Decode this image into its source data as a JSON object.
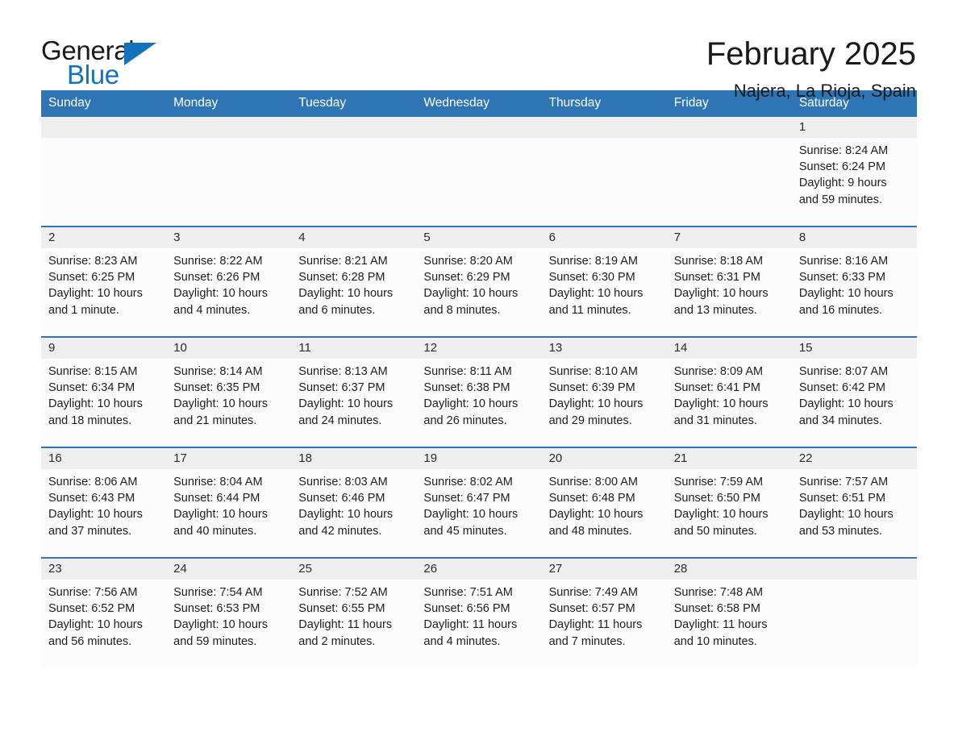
{
  "brand": {
    "name_part1": "General",
    "name_part2": "Blue",
    "accent_color": "#1272bb"
  },
  "header": {
    "month_title": "February 2025",
    "location": "Najera, La Rioja, Spain"
  },
  "calendar": {
    "header_color": "#2e75b6",
    "weekday_headers": [
      "Sunday",
      "Monday",
      "Tuesday",
      "Wednesday",
      "Thursday",
      "Friday",
      "Saturday"
    ],
    "weeks": [
      [
        {
          "empty": true
        },
        {
          "empty": true
        },
        {
          "empty": true
        },
        {
          "empty": true
        },
        {
          "empty": true
        },
        {
          "empty": true
        },
        {
          "day": "1",
          "sunrise": "Sunrise: 8:24 AM",
          "sunset": "Sunset: 6:24 PM",
          "daylight_line1": "Daylight: 9 hours",
          "daylight_line2": "and 59 minutes."
        }
      ],
      [
        {
          "day": "2",
          "sunrise": "Sunrise: 8:23 AM",
          "sunset": "Sunset: 6:25 PM",
          "daylight_line1": "Daylight: 10 hours",
          "daylight_line2": "and 1 minute."
        },
        {
          "day": "3",
          "sunrise": "Sunrise: 8:22 AM",
          "sunset": "Sunset: 6:26 PM",
          "daylight_line1": "Daylight: 10 hours",
          "daylight_line2": "and 4 minutes."
        },
        {
          "day": "4",
          "sunrise": "Sunrise: 8:21 AM",
          "sunset": "Sunset: 6:28 PM",
          "daylight_line1": "Daylight: 10 hours",
          "daylight_line2": "and 6 minutes."
        },
        {
          "day": "5",
          "sunrise": "Sunrise: 8:20 AM",
          "sunset": "Sunset: 6:29 PM",
          "daylight_line1": "Daylight: 10 hours",
          "daylight_line2": "and 8 minutes."
        },
        {
          "day": "6",
          "sunrise": "Sunrise: 8:19 AM",
          "sunset": "Sunset: 6:30 PM",
          "daylight_line1": "Daylight: 10 hours",
          "daylight_line2": "and 11 minutes."
        },
        {
          "day": "7",
          "sunrise": "Sunrise: 8:18 AM",
          "sunset": "Sunset: 6:31 PM",
          "daylight_line1": "Daylight: 10 hours",
          "daylight_line2": "and 13 minutes."
        },
        {
          "day": "8",
          "sunrise": "Sunrise: 8:16 AM",
          "sunset": "Sunset: 6:33 PM",
          "daylight_line1": "Daylight: 10 hours",
          "daylight_line2": "and 16 minutes."
        }
      ],
      [
        {
          "day": "9",
          "sunrise": "Sunrise: 8:15 AM",
          "sunset": "Sunset: 6:34 PM",
          "daylight_line1": "Daylight: 10 hours",
          "daylight_line2": "and 18 minutes."
        },
        {
          "day": "10",
          "sunrise": "Sunrise: 8:14 AM",
          "sunset": "Sunset: 6:35 PM",
          "daylight_line1": "Daylight: 10 hours",
          "daylight_line2": "and 21 minutes."
        },
        {
          "day": "11",
          "sunrise": "Sunrise: 8:13 AM",
          "sunset": "Sunset: 6:37 PM",
          "daylight_line1": "Daylight: 10 hours",
          "daylight_line2": "and 24 minutes."
        },
        {
          "day": "12",
          "sunrise": "Sunrise: 8:11 AM",
          "sunset": "Sunset: 6:38 PM",
          "daylight_line1": "Daylight: 10 hours",
          "daylight_line2": "and 26 minutes."
        },
        {
          "day": "13",
          "sunrise": "Sunrise: 8:10 AM",
          "sunset": "Sunset: 6:39 PM",
          "daylight_line1": "Daylight: 10 hours",
          "daylight_line2": "and 29 minutes."
        },
        {
          "day": "14",
          "sunrise": "Sunrise: 8:09 AM",
          "sunset": "Sunset: 6:41 PM",
          "daylight_line1": "Daylight: 10 hours",
          "daylight_line2": "and 31 minutes."
        },
        {
          "day": "15",
          "sunrise": "Sunrise: 8:07 AM",
          "sunset": "Sunset: 6:42 PM",
          "daylight_line1": "Daylight: 10 hours",
          "daylight_line2": "and 34 minutes."
        }
      ],
      [
        {
          "day": "16",
          "sunrise": "Sunrise: 8:06 AM",
          "sunset": "Sunset: 6:43 PM",
          "daylight_line1": "Daylight: 10 hours",
          "daylight_line2": "and 37 minutes."
        },
        {
          "day": "17",
          "sunrise": "Sunrise: 8:04 AM",
          "sunset": "Sunset: 6:44 PM",
          "daylight_line1": "Daylight: 10 hours",
          "daylight_line2": "and 40 minutes."
        },
        {
          "day": "18",
          "sunrise": "Sunrise: 8:03 AM",
          "sunset": "Sunset: 6:46 PM",
          "daylight_line1": "Daylight: 10 hours",
          "daylight_line2": "and 42 minutes."
        },
        {
          "day": "19",
          "sunrise": "Sunrise: 8:02 AM",
          "sunset": "Sunset: 6:47 PM",
          "daylight_line1": "Daylight: 10 hours",
          "daylight_line2": "and 45 minutes."
        },
        {
          "day": "20",
          "sunrise": "Sunrise: 8:00 AM",
          "sunset": "Sunset: 6:48 PM",
          "daylight_line1": "Daylight: 10 hours",
          "daylight_line2": "and 48 minutes."
        },
        {
          "day": "21",
          "sunrise": "Sunrise: 7:59 AM",
          "sunset": "Sunset: 6:50 PM",
          "daylight_line1": "Daylight: 10 hours",
          "daylight_line2": "and 50 minutes."
        },
        {
          "day": "22",
          "sunrise": "Sunrise: 7:57 AM",
          "sunset": "Sunset: 6:51 PM",
          "daylight_line1": "Daylight: 10 hours",
          "daylight_line2": "and 53 minutes."
        }
      ],
      [
        {
          "day": "23",
          "sunrise": "Sunrise: 7:56 AM",
          "sunset": "Sunset: 6:52 PM",
          "daylight_line1": "Daylight: 10 hours",
          "daylight_line2": "and 56 minutes."
        },
        {
          "day": "24",
          "sunrise": "Sunrise: 7:54 AM",
          "sunset": "Sunset: 6:53 PM",
          "daylight_line1": "Daylight: 10 hours",
          "daylight_line2": "and 59 minutes."
        },
        {
          "day": "25",
          "sunrise": "Sunrise: 7:52 AM",
          "sunset": "Sunset: 6:55 PM",
          "daylight_line1": "Daylight: 11 hours",
          "daylight_line2": "and 2 minutes."
        },
        {
          "day": "26",
          "sunrise": "Sunrise: 7:51 AM",
          "sunset": "Sunset: 6:56 PM",
          "daylight_line1": "Daylight: 11 hours",
          "daylight_line2": "and 4 minutes."
        },
        {
          "day": "27",
          "sunrise": "Sunrise: 7:49 AM",
          "sunset": "Sunset: 6:57 PM",
          "daylight_line1": "Daylight: 11 hours",
          "daylight_line2": "and 7 minutes."
        },
        {
          "day": "28",
          "sunrise": "Sunrise: 7:48 AM",
          "sunset": "Sunset: 6:58 PM",
          "daylight_line1": "Daylight: 11 hours",
          "daylight_line2": "and 10 minutes."
        },
        {
          "empty": true
        }
      ]
    ]
  }
}
